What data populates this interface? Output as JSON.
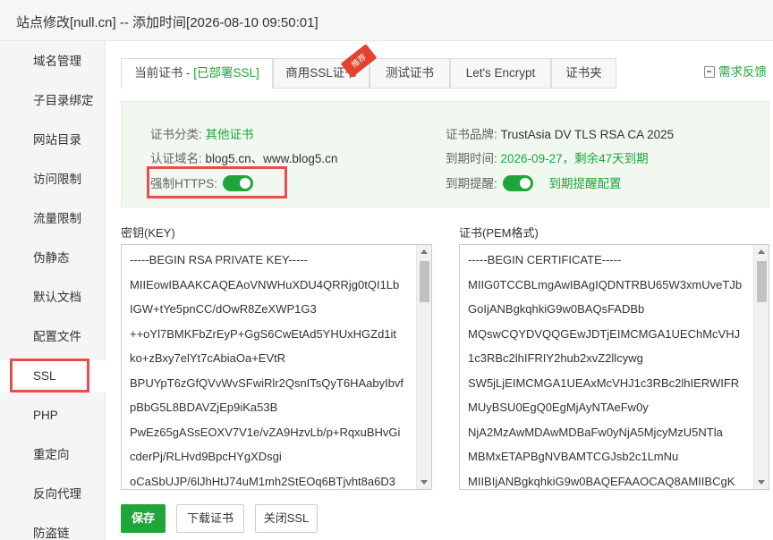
{
  "window": {
    "title": "站点修改[null.cn] -- 添加时间[2026-08-10 09:50:01]"
  },
  "sidebar": {
    "items": [
      {
        "label": "域名管理"
      },
      {
        "label": "子目录绑定"
      },
      {
        "label": "网站目录"
      },
      {
        "label": "访问限制"
      },
      {
        "label": "流量限制"
      },
      {
        "label": "伪静态"
      },
      {
        "label": "默认文档"
      },
      {
        "label": "配置文件"
      },
      {
        "label": "SSL",
        "active": true
      },
      {
        "label": "PHP"
      },
      {
        "label": "重定向"
      },
      {
        "label": "反向代理"
      },
      {
        "label": "防盗链"
      }
    ]
  },
  "tabs": [
    {
      "label": "当前证书 - ",
      "status": "[已部署SSL]",
      "active": true
    },
    {
      "label": "商用SSL证书",
      "badge": "推荐"
    },
    {
      "label": "测试证书"
    },
    {
      "label": "Let's Encrypt"
    },
    {
      "label": "证书夹"
    }
  ],
  "feedback": {
    "label": "需求反馈"
  },
  "cert_info": {
    "category_label": "证书分类:",
    "category_value": "其他证书",
    "domains_label": "认证域名:",
    "domains_value": "blog5.cn、www.blog5.cn",
    "force_https_label": "强制HTTPS:",
    "force_https_on": true,
    "brand_label": "证书品牌:",
    "brand_value": "TrustAsia DV TLS RSA CA 2025",
    "expire_label": "到期时间:",
    "expire_value": "2026-09-27，剩余47天到期",
    "remind_label": "到期提醒:",
    "remind_on": true,
    "remind_link": "到期提醒配置"
  },
  "key_section": {
    "label": "密钥(KEY)",
    "lines": [
      "-----BEGIN RSA PRIVATE KEY-----",
      "MIIEowIBAAKCAQEAoVNWHuXDU4QRRjg0tQI1Lb",
      "IGW+tYe5pnCC/dOwR8ZeXWP1G3",
      "++oYl7BMKFbZrEyP+GgS6CwEtAd5YHUxHGZd1it",
      "ko+zBxy7elYt7cAbiaOa+EVtR",
      "BPUYpT6zGfQVvWvSFwiRlr2QsnITsQyT6HAabyIbvf",
      "pBbG5L8BDAVZjEp9iKa53B",
      "PwEz65gASsEOXV7V1e/vZA9HzvLb/p+RqxuBHvGi",
      "cderPj/RLHvd9BpcHYgXDsgi",
      "oCaSbUJP/6lJhHtJ74uM1mh2StEOq6BTjvht8a6D3"
    ]
  },
  "cert_section": {
    "label": "证书(PEM格式)",
    "lines": [
      "-----BEGIN CERTIFICATE-----",
      "MIIG0TCCBLmgAwIBAgIQDNTRBU65W3xmUveTJb",
      "GoIjANBgkqhkiG9w0BAQsFADBb",
      "MQswCQYDVQQGEwJDTjEIMCMGA1UEChMcVHJ",
      "1c3RBc2lhIFRIY2hub2xvZ2llcywg",
      "SW5jLjEIMCMGA1UEAxMcVHJ1c3RBc2lhIERWIFR",
      "MUyBSU0EgQ0EgMjAyNTAeFw0y",
      "NjA2MzAwMDAwMDBaFw0yNjA5MjcyMzU5NTla",
      "MBMxETAPBgNVBAMTCGJsb2c1LmNu",
      "MIIBIjANBgkqhkiG9w0BAQEFAAOCAQ8AMIIBCgK"
    ]
  },
  "buttons": {
    "save": "保存",
    "download": "下载证书",
    "close_ssl": "关闭SSL"
  },
  "colors": {
    "accent": "#20a53a",
    "highlight": "#e64d4d",
    "badge": "#e5412e"
  }
}
